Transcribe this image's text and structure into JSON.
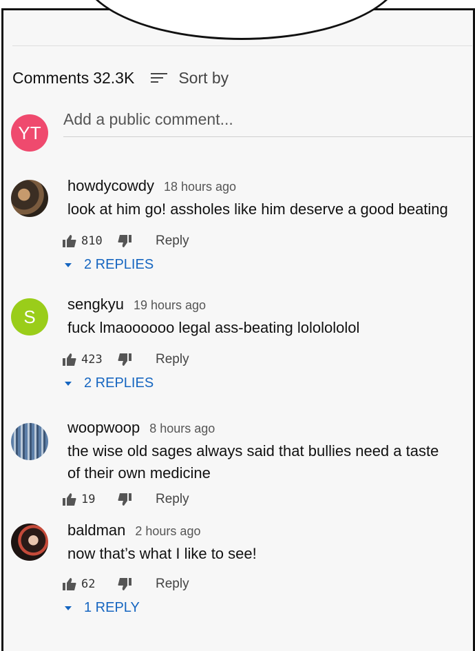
{
  "comments_section": {
    "title": "Comments",
    "count": "32.3K",
    "sort_label": "Sort by",
    "add_comment": {
      "avatar_letters": "YT",
      "avatar_color": "#ef4a6e",
      "placeholder": "Add a public comment..."
    }
  },
  "comments": [
    {
      "author": "howdycowdy",
      "time": "18 hours ago",
      "text": "look at him go! assholes like him deserve a good beating",
      "likes": "810",
      "reply_label": "Reply",
      "replies_label": "2 REPLIES"
    },
    {
      "author": "sengkyu",
      "time": "19 hours ago",
      "text": "fuck lmaoooooo legal ass-beating lololololol",
      "likes": "423",
      "reply_label": "Reply",
      "replies_label": "2 REPLIES",
      "avatar_letter": "S",
      "avatar_color": "#9acd1a"
    },
    {
      "author": "woopwoop",
      "time": "8 hours ago",
      "text": "the wise old sages always said that bullies need a taste of their own medicine",
      "likes": "19",
      "reply_label": "Reply"
    },
    {
      "author": "baldman",
      "time": "2 hours ago",
      "text": "now that’s what I like to see!",
      "likes": "62",
      "reply_label": "Reply",
      "replies_label": "1 REPLY"
    }
  ]
}
